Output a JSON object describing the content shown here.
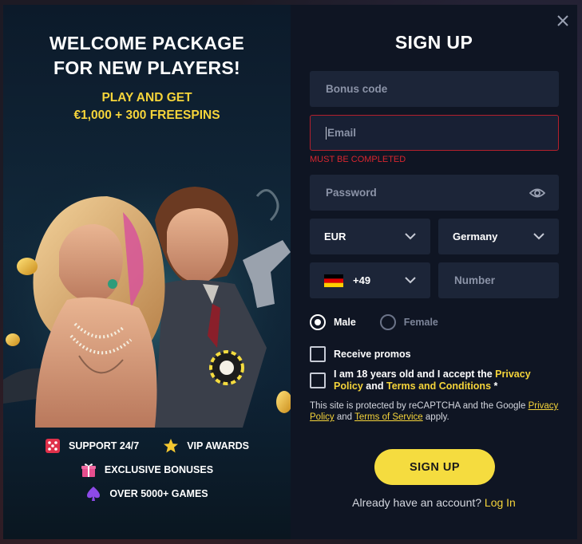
{
  "promo": {
    "title_line1": "WELCOME PACKAGE",
    "title_line2": "FOR NEW PLAYERS!",
    "sub_line1": "PLAY AND GET",
    "sub_line2": "€1,000 + 300 FREESPINS",
    "features": {
      "support": "SUPPORT 24/7",
      "vip": "VIP AWARDS",
      "bonuses": "EXCLUSIVE BONUSES",
      "games": "OVER 5000+ GAMES"
    }
  },
  "signup": {
    "title": "SIGN UP",
    "bonus_placeholder": "Bonus code",
    "email_placeholder": "Email",
    "email_error": "MUST BE COMPLETED",
    "password_placeholder": "Password",
    "currency": "EUR",
    "country": "Germany",
    "phone_code": "+49",
    "number_placeholder": "Number",
    "gender": {
      "male": "Male",
      "female": "Female",
      "selected": "male"
    },
    "promos_label": "Receive promos",
    "terms": {
      "prefix": "I am 18 years old and I accept the ",
      "privacy": "Privacy Policy",
      "and": " and ",
      "tnc": "Terms and Conditions",
      "suffix": " *"
    },
    "recaptcha": {
      "text1": "This site is protected by reCAPTCHA and the Google ",
      "privacy": "Privacy Policy",
      "and": " and ",
      "tos": "Terms of Service",
      "apply": " apply."
    },
    "submit": "SIGN UP",
    "login_prompt": "Already have an account? ",
    "login_link": "Log In"
  },
  "colors": {
    "accent": "#f5dc3f",
    "error": "#d8262f",
    "panel": "#0f1523",
    "field": "#1c2538"
  },
  "icons": [
    "close-icon",
    "eye-icon",
    "chevron-down-icon",
    "germany-flag-icon",
    "dice-icon",
    "star-icon",
    "gift-icon",
    "spade-icon"
  ]
}
